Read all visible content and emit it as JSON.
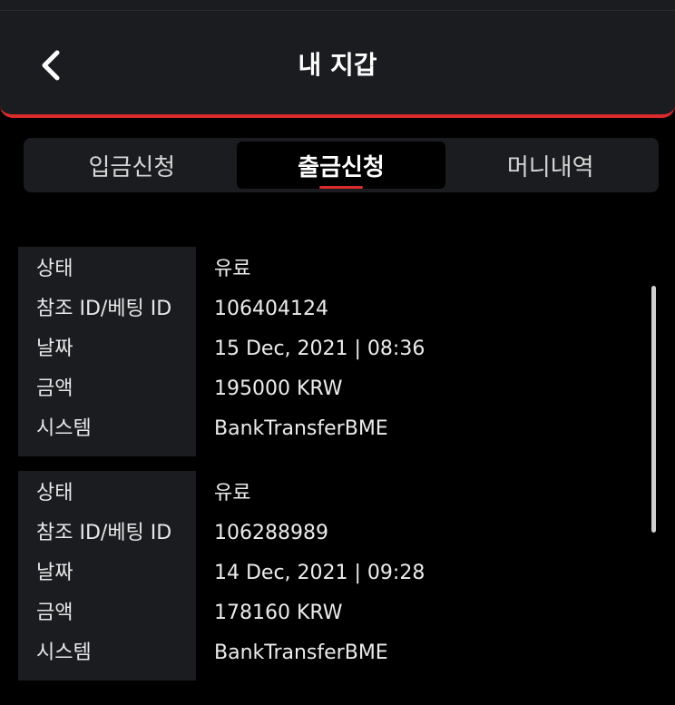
{
  "header": {
    "title": "내 지갑"
  },
  "tabs": [
    {
      "label": "입금신청",
      "active": false
    },
    {
      "label": "출금신청",
      "active": true
    },
    {
      "label": "머니내역",
      "active": false
    }
  ],
  "field_labels": {
    "status": "상태",
    "ref_id": "참조 ID/베팅 ID",
    "date": "날짜",
    "amount": "금액",
    "system": "시스템"
  },
  "records": [
    {
      "status": "유료",
      "ref_id": "106404124",
      "date": "15 Dec, 2021 | 08:36",
      "amount": "195000 KRW",
      "system": "BankTransferBME"
    },
    {
      "status": "유료",
      "ref_id": "106288989",
      "date": "14 Dec, 2021 | 09:28",
      "amount": "178160 KRW",
      "system": "BankTransferBME"
    }
  ],
  "colors": {
    "accent": "#d92b2b",
    "background": "#000000",
    "surface": "#1b1c1f"
  },
  "icons": {
    "back": "chevron-left-icon"
  }
}
